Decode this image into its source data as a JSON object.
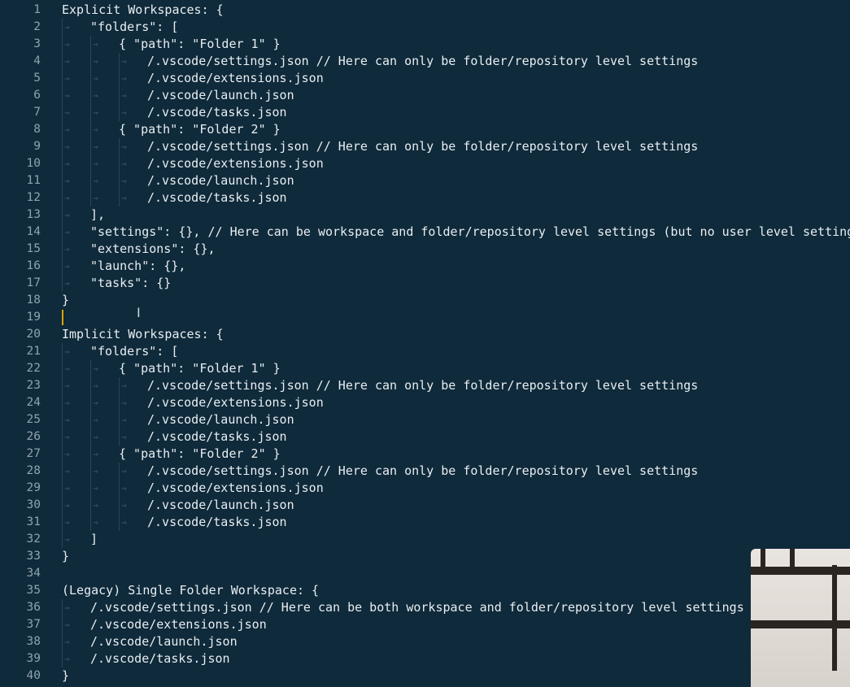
{
  "editor": {
    "lines": [
      {
        "num": "1",
        "indent": 0,
        "text": "Explicit Workspaces: {"
      },
      {
        "num": "2",
        "indent": 1,
        "text": "\"folders\": ["
      },
      {
        "num": "3",
        "indent": 2,
        "text": "{ \"path\": \"Folder 1\" }"
      },
      {
        "num": "4",
        "indent": 3,
        "text": "/.vscode/settings.json // Here can only be folder/repository level settings"
      },
      {
        "num": "5",
        "indent": 3,
        "text": "/.vscode/extensions.json"
      },
      {
        "num": "6",
        "indent": 3,
        "text": "/.vscode/launch.json"
      },
      {
        "num": "7",
        "indent": 3,
        "text": "/.vscode/tasks.json"
      },
      {
        "num": "8",
        "indent": 2,
        "text": "{ \"path\": \"Folder 2\" }"
      },
      {
        "num": "9",
        "indent": 3,
        "text": "/.vscode/settings.json // Here can only be folder/repository level settings"
      },
      {
        "num": "10",
        "indent": 3,
        "text": "/.vscode/extensions.json"
      },
      {
        "num": "11",
        "indent": 3,
        "text": "/.vscode/launch.json"
      },
      {
        "num": "12",
        "indent": 3,
        "text": "/.vscode/tasks.json"
      },
      {
        "num": "13",
        "indent": 1,
        "text": "],"
      },
      {
        "num": "14",
        "indent": 1,
        "text": "\"settings\": {}, // Here can be workspace and folder/repository level settings (but no user level settings)"
      },
      {
        "num": "15",
        "indent": 1,
        "text": "\"extensions\": {},"
      },
      {
        "num": "16",
        "indent": 1,
        "text": "\"launch\": {},"
      },
      {
        "num": "17",
        "indent": 1,
        "text": "\"tasks\": {}"
      },
      {
        "num": "18",
        "indent": 0,
        "text": "}"
      },
      {
        "num": "19",
        "indent": 0,
        "text": ""
      },
      {
        "num": "20",
        "indent": 0,
        "text": "Implicit Workspaces: {"
      },
      {
        "num": "21",
        "indent": 1,
        "text": "\"folders\": ["
      },
      {
        "num": "22",
        "indent": 2,
        "text": "{ \"path\": \"Folder 1\" }"
      },
      {
        "num": "23",
        "indent": 3,
        "text": "/.vscode/settings.json // Here can only be folder/repository level settings"
      },
      {
        "num": "24",
        "indent": 3,
        "text": "/.vscode/extensions.json"
      },
      {
        "num": "25",
        "indent": 3,
        "text": "/.vscode/launch.json"
      },
      {
        "num": "26",
        "indent": 3,
        "text": "/.vscode/tasks.json"
      },
      {
        "num": "27",
        "indent": 2,
        "text": "{ \"path\": \"Folder 2\" }"
      },
      {
        "num": "28",
        "indent": 3,
        "text": "/.vscode/settings.json // Here can only be folder/repository level settings"
      },
      {
        "num": "29",
        "indent": 3,
        "text": "/.vscode/extensions.json"
      },
      {
        "num": "30",
        "indent": 3,
        "text": "/.vscode/launch.json"
      },
      {
        "num": "31",
        "indent": 3,
        "text": "/.vscode/tasks.json"
      },
      {
        "num": "32",
        "indent": 1,
        "text": "]"
      },
      {
        "num": "33",
        "indent": 0,
        "text": "}"
      },
      {
        "num": "34",
        "indent": 0,
        "text": ""
      },
      {
        "num": "35",
        "indent": 0,
        "text": "(Legacy) Single Folder Workspace: {"
      },
      {
        "num": "36",
        "indent": 1,
        "text": "/.vscode/settings.json // Here can be both workspace and folder/repository level settings"
      },
      {
        "num": "37",
        "indent": 1,
        "text": "/.vscode/extensions.json"
      },
      {
        "num": "38",
        "indent": 1,
        "text": "/.vscode/launch.json"
      },
      {
        "num": "39",
        "indent": 1,
        "text": "/.vscode/tasks.json"
      },
      {
        "num": "40",
        "indent": 0,
        "text": "}"
      }
    ],
    "active_line": "19",
    "cursor_color": "#d9a400"
  },
  "colors": {
    "background": "#0f2a3a",
    "text": "#e8eef2",
    "line_number": "#8fa3b0"
  }
}
